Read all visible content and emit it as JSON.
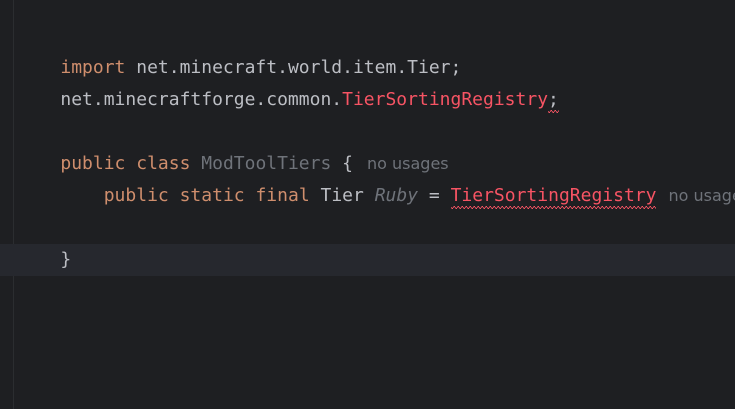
{
  "editor": {
    "colors": {
      "background": "#1e1f22",
      "keyword": "#cf8e6d",
      "plain": "#bcbec4",
      "error": "#f75464",
      "unused": "#6f737a",
      "current_line": "#26282e"
    },
    "line1": {
      "kw": "import",
      "rest": " net.minecraft.world.item.Tier;"
    },
    "line2": {
      "prefix": "net.minecraftforge.common.",
      "error_symbol": "TierSortingRegistry",
      "suffix": ";"
    },
    "line4": {
      "kw1": "public",
      "kw2": "class",
      "class_name": "ModToolTiers",
      "brace": " {",
      "hint": "no usages"
    },
    "line5": {
      "indent": "    ",
      "kw1": "public",
      "kw2": "static",
      "kw3": "final",
      "type": "Tier",
      "field": "Ruby",
      "equals": " = ",
      "error_symbol": "TierSortingRegistry",
      "hint": "no usages"
    },
    "line7": {
      "brace": "}"
    }
  }
}
